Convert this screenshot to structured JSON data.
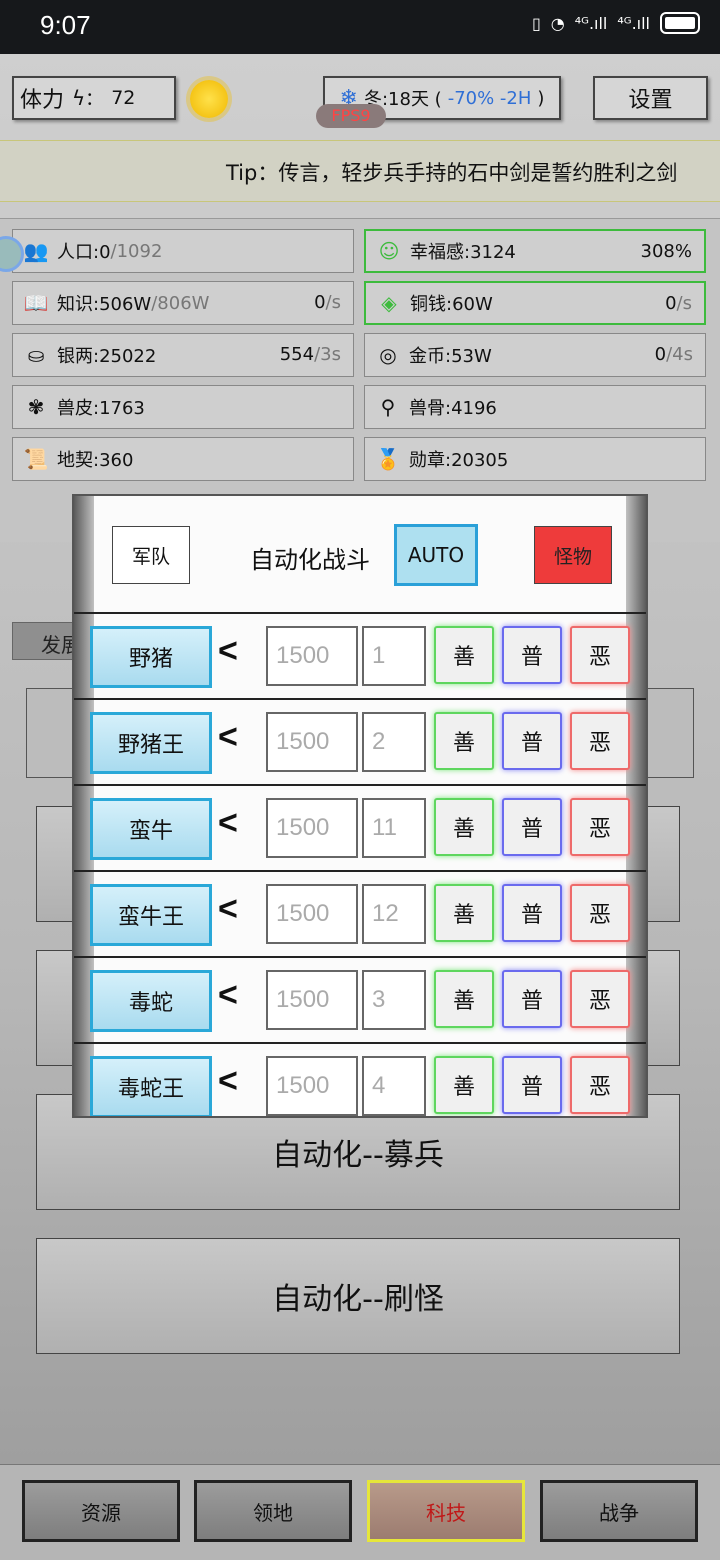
{
  "status_bar": {
    "time": "9:07",
    "signal_1": "⁴ᴳ.ıll",
    "signal_2": "⁴ᴳ.ıll"
  },
  "header": {
    "stamina_label": "体力",
    "stamina_sep": "：",
    "stamina_value": "72",
    "season_text": "冬:18天 (",
    "season_modifier": "-70% -2H",
    "season_close": ")",
    "settings_label": "设置",
    "fps_label": "FPS9"
  },
  "tip": {
    "text": "Tip：传言，轻步兵手持的石中剑是誓约胜利之剑"
  },
  "resources": [
    {
      "name": "人口:0",
      "extra": "/1092",
      "rate": "",
      "rate_unit": "",
      "icon": "people-icon"
    },
    {
      "name": "幸福感:3124",
      "extra": "",
      "rate": "308%",
      "rate_unit": "",
      "icon": "smile-icon"
    },
    {
      "name": "知识:506W",
      "extra": "/806W",
      "rate": "0",
      "rate_unit": "/s",
      "icon": "book-icon"
    },
    {
      "name": "铜钱:60W",
      "extra": "",
      "rate": "0",
      "rate_unit": "/s",
      "icon": "copper-coin-icon"
    },
    {
      "name": "银两:25022",
      "extra": "",
      "rate": "554",
      "rate_unit": "/3s",
      "icon": "silver-ingot-icon"
    },
    {
      "name": "金币:53W",
      "extra": "",
      "rate": "0",
      "rate_unit": "/4s",
      "icon": "gold-coin-icon"
    },
    {
      "name": "兽皮:1763",
      "extra": "",
      "rate": "",
      "rate_unit": "",
      "icon": "hide-icon"
    },
    {
      "name": "兽骨:4196",
      "extra": "",
      "rate": "",
      "rate_unit": "",
      "icon": "bone-icon"
    },
    {
      "name": "地契:360",
      "extra": "",
      "rate": "",
      "rate_unit": "",
      "icon": "deed-icon"
    },
    {
      "name": "勋章:20305",
      "extra": "",
      "rate": "",
      "rate_unit": "",
      "icon": "medal-icon"
    }
  ],
  "background_menu": {
    "tab_label": "发展",
    "items": [
      "",
      "",
      "",
      "自动化--募兵",
      "自动化--刷怪"
    ]
  },
  "modal": {
    "army_label": "军队",
    "title": "自动化战斗",
    "auto_label": "AUTO",
    "monster_label": "怪物",
    "less_than": "<",
    "align_good": "善",
    "align_neutral": "普",
    "align_evil": "恶",
    "rows": [
      {
        "name": "野猪",
        "threshold": "1500",
        "rank": "1"
      },
      {
        "name": "野猪王",
        "threshold": "1500",
        "rank": "2"
      },
      {
        "name": "蛮牛",
        "threshold": "1500",
        "rank": "11"
      },
      {
        "name": "蛮牛王",
        "threshold": "1500",
        "rank": "12"
      },
      {
        "name": "毒蛇",
        "threshold": "1500",
        "rank": "3"
      },
      {
        "name": "毒蛇王",
        "threshold": "1500",
        "rank": "4"
      }
    ]
  },
  "bottom_nav": {
    "items": [
      "资源",
      "领地",
      "科技",
      "战争"
    ],
    "active": "科技"
  },
  "colors": {
    "accent_blue": "#2aa8d8",
    "monster_red": "#ee3b3b",
    "active_tab_border": "#e6e63a",
    "happiness_green": "#3dbb3d"
  }
}
